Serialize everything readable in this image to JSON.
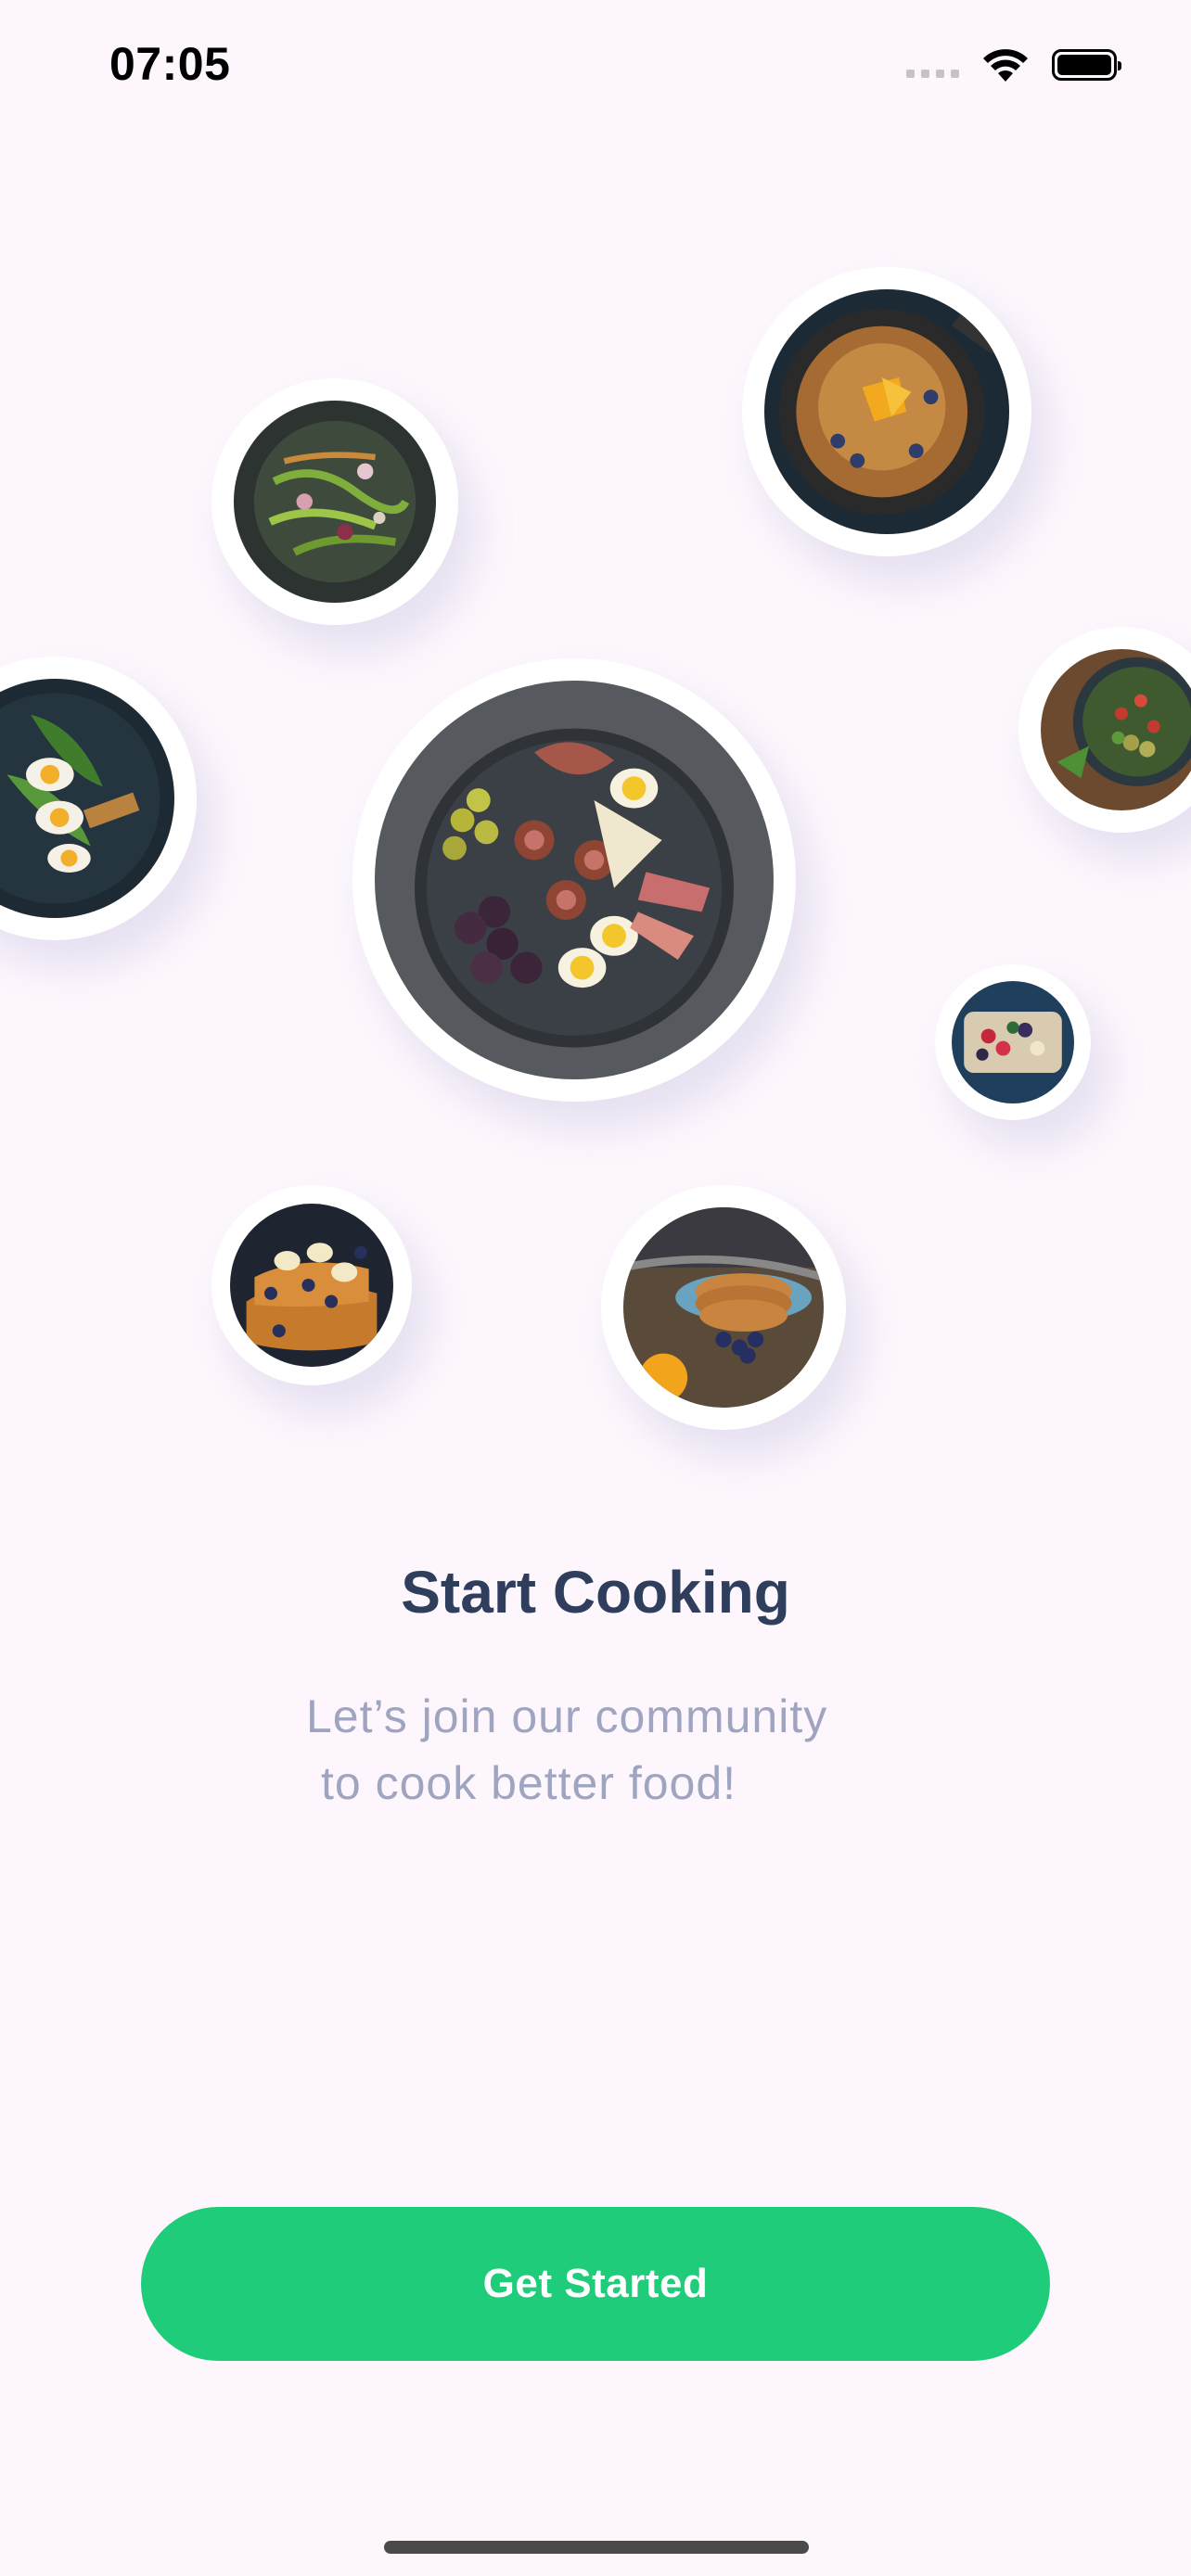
{
  "status_bar": {
    "time": "07:05"
  },
  "dishes": [
    {
      "name": "herb-salad"
    },
    {
      "name": "skillet-pancake"
    },
    {
      "name": "egg-salad"
    },
    {
      "name": "charcuterie-platter"
    },
    {
      "name": "bean-salad-bowl"
    },
    {
      "name": "berry-breakfast-board"
    },
    {
      "name": "banana-french-toast"
    },
    {
      "name": "blueberry-pancake-stack"
    }
  ],
  "onboarding": {
    "title": "Start Cooking",
    "subtitle_line1": "Let’s join our community",
    "subtitle_line2": "to cook better food!",
    "cta_label": "Get Started"
  },
  "colors": {
    "background": "#fdf7fd",
    "accent": "#1fcc79",
    "title": "#2e3e5c",
    "subtitle": "#9fa5c0"
  }
}
